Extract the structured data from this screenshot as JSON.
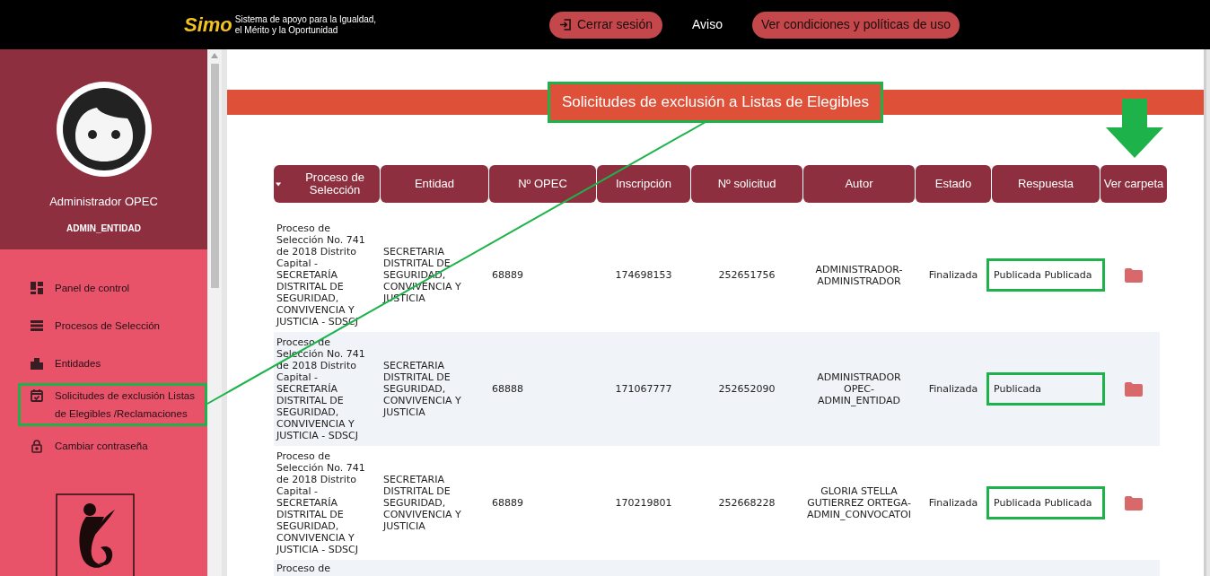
{
  "top_bar": {
    "logo_text": "Simo",
    "tagline": [
      "Sistema de apoyo para la Igualdad,",
      "el Mérito y la Oportunidad"
    ],
    "logout_button": "Cerrar sesión",
    "notice_link": "Aviso",
    "terms_button": "Ver condiciones y políticas de uso"
  },
  "sidebar": {
    "user_name": "Administrador OPEC",
    "user_role": "ADMIN_ENTIDAD",
    "items": [
      {
        "kind": "dashboard",
        "label": "Panel de control",
        "highlighted": false
      },
      {
        "kind": "list",
        "label": "Procesos de Selección",
        "highlighted": false
      },
      {
        "kind": "building",
        "label": "Entidades",
        "highlighted": false
      },
      {
        "kind": "calendar",
        "label": "Solicitudes de exclusión Listas de Elegibles /Reclamaciones",
        "highlighted": true
      },
      {
        "kind": "lock",
        "label": "Cambiar contraseña",
        "highlighted": false
      }
    ]
  },
  "page_title": {
    "text": "Solicitudes de exclusión a Listas de Elegibles",
    "highlighted": true
  },
  "table": {
    "columns": [
      "Proceso de Selección",
      "Entidad",
      "Nº OPEC",
      "Inscripción",
      "Nº solicitud",
      "Autor",
      "Estado",
      "Respuesta",
      "Ver carpeta"
    ],
    "rows": [
      {
        "process": "Proceso de Selección No. 741 de 2018 Distrito Capital - SECRETARÍA DISTRITAL DE SEGURIDAD, CONVIVENCIA Y JUSTICIA - SDSCJ",
        "entity": "SECRETARIA DISTRITAL DE SEGURIDAD, CONVIVENCIA Y JUSTICIA",
        "opec": "68889",
        "registration": "174698153",
        "request": "252651756",
        "author": "ADMINISTRADOR-ADMINISTRADOR",
        "status": "Finalizada",
        "response": "Publicada Publicada",
        "highlighted": true
      },
      {
        "process": "Proceso de Selección No. 741 de 2018 Distrito Capital - SECRETARÍA DISTRITAL DE SEGURIDAD, CONVIVENCIA Y JUSTICIA - SDSCJ",
        "entity": "SECRETARIA DISTRITAL DE SEGURIDAD, CONVIVENCIA Y JUSTICIA",
        "opec": "68888",
        "registration": "171067777",
        "request": "252652090",
        "author": "ADMINISTRADOR OPEC-ADMIN_ENTIDAD",
        "status": "Finalizada",
        "response": "Publicada",
        "highlighted": true
      },
      {
        "process": "Proceso de Selección No. 741 de 2018 Distrito Capital - SECRETARÍA DISTRITAL DE SEGURIDAD, CONVIVENCIA Y JUSTICIA - SDSCJ",
        "entity": "SECRETARIA DISTRITAL DE SEGURIDAD, CONVIVENCIA Y JUSTICIA",
        "opec": "68889",
        "registration": "170219801",
        "request": "252668228",
        "author": "GLORIA STELLA GUTIERREZ ORTEGA-ADMIN_CONVOCATOI",
        "status": "Finalizada",
        "response": "Publicada Publicada",
        "highlighted": true
      },
      {
        "process": "Proceso de"
      }
    ]
  }
}
